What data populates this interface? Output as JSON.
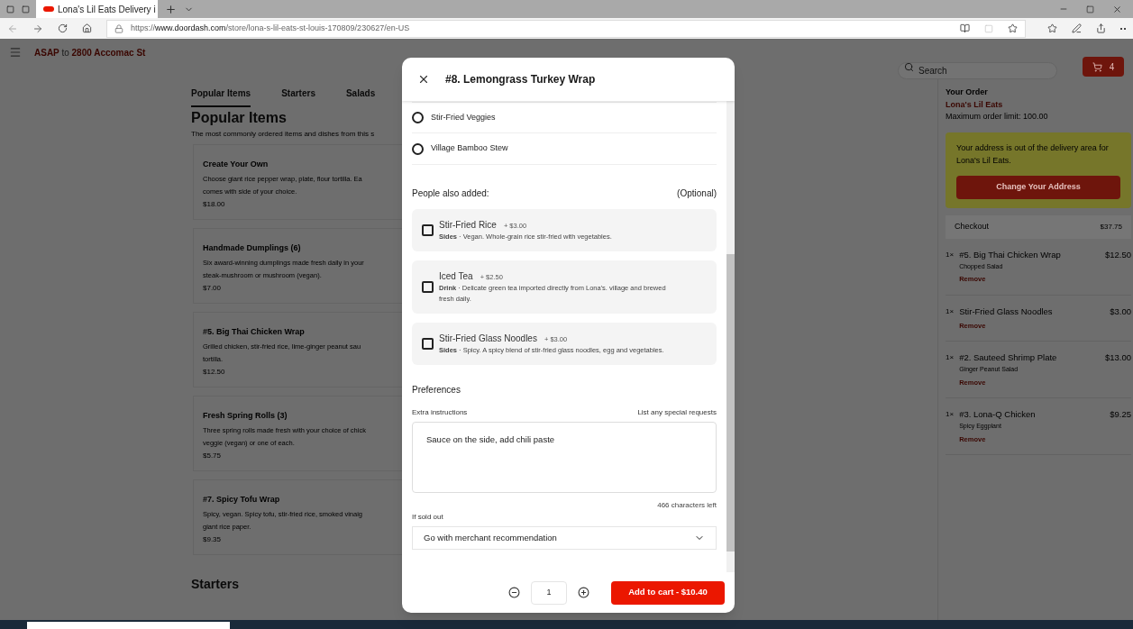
{
  "browser": {
    "tab_title": "Lona's Lil Eats Delivery i",
    "url_prefix": "https://",
    "url_domain": "www.doordash.com",
    "url_path": "/store/lona-s-lil-eats-st-louis-170809/230627/en-US"
  },
  "header": {
    "asap": "ASAP",
    "to": "to",
    "address": "2800 Accomac St",
    "search_placeholder": "Search",
    "cart_count": "4"
  },
  "menu_tabs": [
    {
      "label": "Popular Items",
      "selected": true
    },
    {
      "label": "Starters",
      "selected": false
    },
    {
      "label": "Salads",
      "selected": false
    }
  ],
  "section": {
    "title": "Popular Items",
    "subtitle": "The most commonly ordered items and dishes from this s"
  },
  "menu_items": [
    {
      "name": "Create Your Own",
      "desc_lines": [
        "Choose giant rice pepper wrap, plate, flour tortilla. Ea",
        "comes with side of your choice."
      ],
      "price": "$18.00"
    },
    {
      "name": "Handmade Dumplings (6)",
      "desc_lines": [
        "Six award-winning dumplings made fresh daily in your",
        "steak-mushroom or mushroom (vegan)."
      ],
      "price": "$7.00"
    },
    {
      "name": "#5. Big Thai Chicken Wrap",
      "desc_lines": [
        "Grilled chicken, stir-fried rice, lime-ginger peanut sau",
        "tortilla."
      ],
      "price": "$12.50"
    },
    {
      "name": "Fresh Spring Rolls (3)",
      "desc_lines": [
        "Three spring rolls made fresh with your choice of chick",
        "veggie (vegan) or one of each."
      ],
      "price": "$5.75"
    },
    {
      "name": "#7. Spicy Tofu Wrap",
      "desc_lines": [
        "Spicy, vegan. Spicy tofu, stir-fried rice, smoked vinaig",
        "giant rice paper."
      ],
      "price": "$9.35"
    }
  ],
  "next_section": "Starters",
  "order": {
    "title": "Your Order",
    "store": "Lona's Lil Eats",
    "limit": "Maximum order limit: 100.00",
    "warning": "Your address is out of the delivery area for Lona's Lil Eats.",
    "change_button": "Change Your Address",
    "checkout": "Checkout",
    "checkout_total": "$37.75",
    "items": [
      {
        "qty": "1×",
        "name": "#5. Big Thai Chicken Wrap",
        "price": "$12.50",
        "option": "Chopped Salad",
        "remove": "Remove"
      },
      {
        "qty": "1×",
        "name": "Stir-Fried Glass Noodles",
        "price": "$3.00",
        "remove": "Remove"
      },
      {
        "qty": "1×",
        "name": "#2. Sauteed Shrimp Plate",
        "price": "$13.00",
        "option": "Ginger Peanut Salad",
        "remove": "Remove"
      },
      {
        "qty": "1×",
        "name": "#3. Lona-Q Chicken",
        "price": "$9.25",
        "option": "Spicy Eggplant",
        "remove": "Remove"
      }
    ]
  },
  "modal": {
    "title": "#8. Lemongrass Turkey Wrap",
    "radio_options": [
      {
        "label": "Stir-Fried Veggies",
        "selected": false
      },
      {
        "label": "Village Bamboo Stew",
        "selected": false
      }
    ],
    "also_added_title": "People also added:",
    "also_added_note": "(Optional)",
    "addons": [
      {
        "name": "Stir-Fried Rice",
        "price": "+ $3.00",
        "desc": "**Sides** · Vegan. Whole-grain rice stir-fried with vegetables.",
        "checked": false
      },
      {
        "name": "Iced Tea",
        "price": "+ $2.50",
        "desc": "**Drink** · Delicate green tea imported directly from Lona's. village and brewed fresh daily.",
        "checked": false
      },
      {
        "name": "Stir-Fried Glass Noodles",
        "price": "+ $3.00",
        "desc": "**Sides** · Spicy. A spicy blend of stir-fried glass noodles, egg and vegetables.",
        "checked": false
      }
    ],
    "preferences_title": "Preferences",
    "instructions_label": "Extra instructions",
    "instructions_hint": "List any special requests",
    "instructions_value": "Sauce on the side, add chili paste",
    "chars_left": "466 characters left",
    "sold_out_label": "If sold out",
    "sold_out_value": "Go with merchant recommendation",
    "quantity": "1",
    "add_button": "Add to cart - $10.40"
  }
}
